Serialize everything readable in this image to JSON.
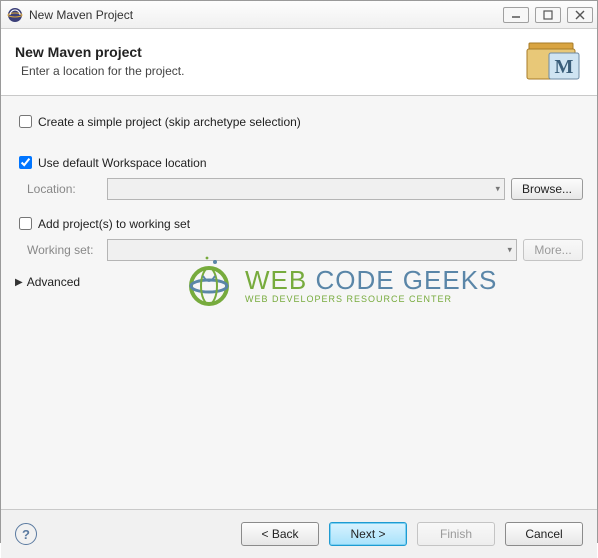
{
  "window": {
    "title": "New Maven Project"
  },
  "banner": {
    "title": "New Maven project",
    "subtitle": "Enter a location for the project."
  },
  "options": {
    "simple_project": {
      "label": "Create a simple project (skip archetype selection)",
      "checked": false
    },
    "default_workspace": {
      "label": "Use default Workspace location",
      "checked": true
    },
    "location_label": "Location:",
    "browse_label": "Browse...",
    "add_working_set": {
      "label": "Add project(s) to working set",
      "checked": false
    },
    "working_set_label": "Working set:",
    "more_label": "More...",
    "advanced_label": "Advanced"
  },
  "watermark": {
    "line1_a": "WEB ",
    "line1_b": "CODE GEEKS",
    "line2": "WEB DEVELOPERS RESOURCE CENTER"
  },
  "buttons": {
    "back": "< Back",
    "next": "Next >",
    "finish": "Finish",
    "cancel": "Cancel"
  },
  "help_glyph": "?"
}
